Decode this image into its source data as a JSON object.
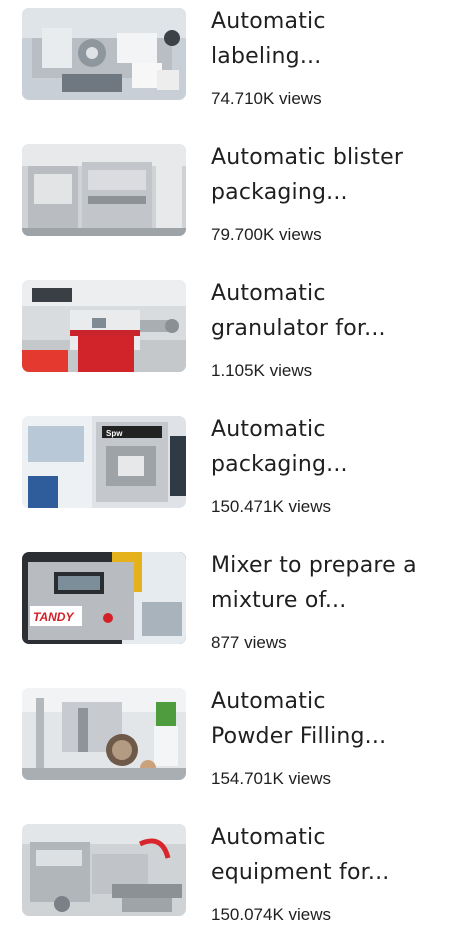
{
  "colors": {
    "title_text": "#1f1f1f",
    "views_text": "#1f1f1f",
    "background": "#ffffff"
  },
  "videos": [
    {
      "title": "Automatic\nlabeling...",
      "views": "74.710K views",
      "thumbnail_icon": "labeling-machine-thumbnail"
    },
    {
      "title": "Automatic blister\npackaging...",
      "views": "79.700K views",
      "thumbnail_icon": "blister-packaging-machine-thumbnail"
    },
    {
      "title": "Automatic\ngranulator for...",
      "views": "1.105K views",
      "thumbnail_icon": "granulator-machine-thumbnail"
    },
    {
      "title": "Automatic\npackaging...",
      "views": "150.471K views",
      "thumbnail_icon": "packaging-machine-thumbnail",
      "thumbnail_text": "Spw"
    },
    {
      "title": "Mixer to prepare a\nmixture of...",
      "views": "877 views",
      "thumbnail_icon": "mixer-machine-thumbnail",
      "thumbnail_text": "TANDY"
    },
    {
      "title": "Automatic\nPowder Filling...",
      "views": "154.701K views",
      "thumbnail_icon": "powder-filling-machine-thumbnail"
    },
    {
      "title": "Automatic\nequipment for...",
      "views": "150.074K views",
      "thumbnail_icon": "automatic-equipment-thumbnail"
    }
  ]
}
